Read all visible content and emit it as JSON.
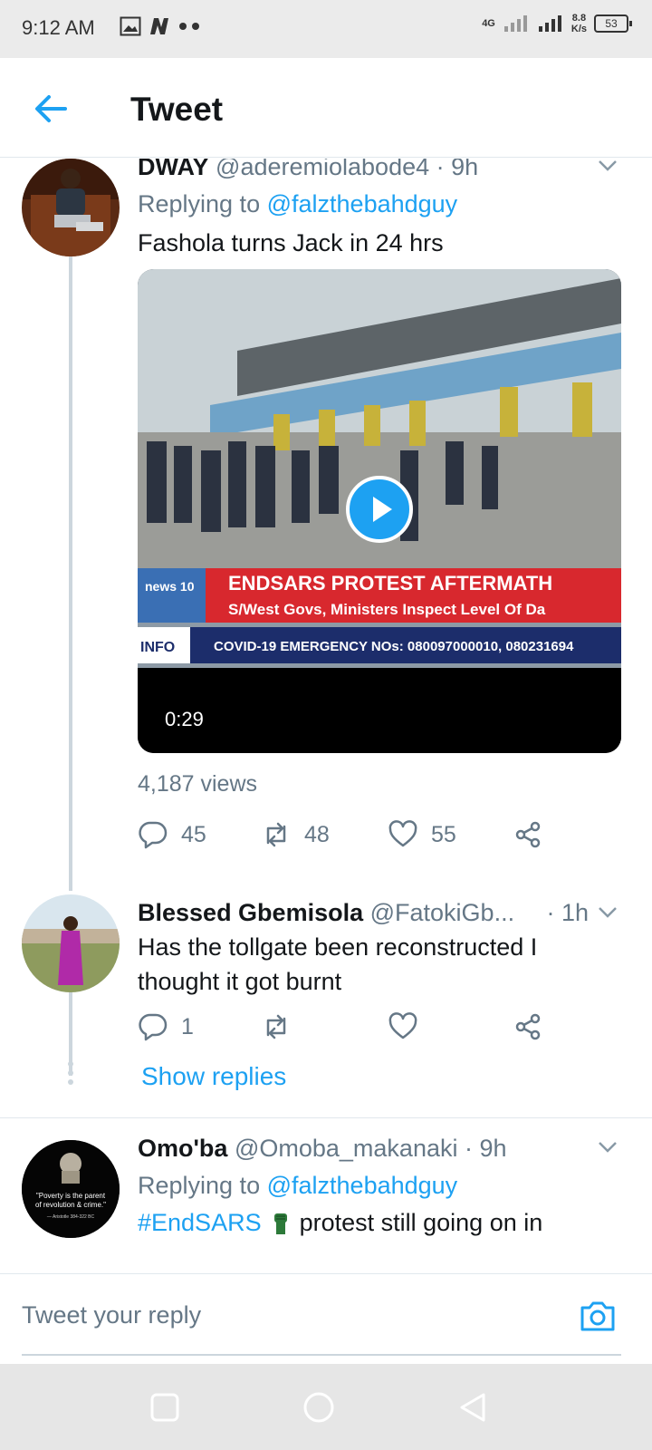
{
  "status_bar": {
    "time": "9:12 AM",
    "network_label": "4G",
    "speed": "8.8",
    "speed_unit": "K/s",
    "battery": "53"
  },
  "header": {
    "title": "Tweet"
  },
  "tweets": [
    {
      "name": "DWAY",
      "handle": "@aderemiolabode4",
      "time": "· 9h",
      "replying_label": "Replying to",
      "replying_to": "@falzthebahdguy",
      "text": "Fashola turns Jack in 24 hrs",
      "video": {
        "banner_title": "ENDSARS PROTEST AFTERMATH",
        "banner_sub": "S/West Govs, Ministers Inspect Level Of Da",
        "ticker_label": "INFO",
        "ticker_text": "COVID-19 EMERGENCY NOs: 080097000010, 080231694",
        "logo": "news 10",
        "duration": "0:29"
      },
      "views": "4,187 views",
      "replies": "45",
      "retweets": "48",
      "likes": "55"
    },
    {
      "name": "Blessed Gbemisola",
      "handle": "@FatokiGb...",
      "time": "· 1h",
      "text": "Has the tollgate been reconstructed I thought it got burnt",
      "replies": "1",
      "retweets": "",
      "likes": "",
      "show_replies": "Show replies"
    },
    {
      "name": "Omo'ba",
      "handle": "@Omoba_makanaki",
      "time": "· 9h",
      "replying_label": "Replying to",
      "replying_to": "@falzthebahdguy",
      "hashtag": "#EndSARS",
      "text": "protest still going on in",
      "avatar_quote": "\"Poverty is the parent of revolution & crime.\"",
      "avatar_attribution": "— Aristotle 384-322 BC"
    }
  ],
  "reply_bar": {
    "placeholder": "Tweet your reply"
  },
  "icons": {
    "back": "arrow-left-icon",
    "caret": "chevron-down-icon",
    "reply": "reply-bubble-icon",
    "retweet": "retweet-icon",
    "like": "heart-icon",
    "share": "share-icon",
    "camera": "camera-icon"
  },
  "colors": {
    "accent": "#1da1f2",
    "secondary_text": "#657786",
    "thread_line": "#ccd6dd"
  }
}
